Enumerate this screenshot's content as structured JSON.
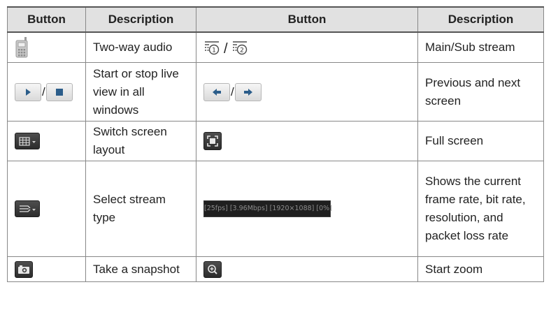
{
  "table": {
    "headers": [
      "Button",
      "Description",
      "Button",
      "Description"
    ],
    "rows": [
      {
        "left_desc": "Two-way audio",
        "right_desc": "Main/Sub stream",
        "left_icon": "phone-icon",
        "right_icon": "main-sub-stream-icon"
      },
      {
        "left_desc": "Start or stop live view in all windows",
        "right_desc": "Previous and next screen",
        "left_icon": "play-stop-icon",
        "right_icon": "prev-next-icon"
      },
      {
        "left_desc": "Switch screen layout",
        "right_desc": "Full screen",
        "left_icon": "grid-layout-icon",
        "right_icon": "fullscreen-icon"
      },
      {
        "left_desc": "Select stream type",
        "right_desc": "Shows the current frame rate, bit rate, resolution, and packet loss rate",
        "left_icon": "stream-type-icon",
        "right_icon": "status-bar",
        "status_text": "[25fps] [3.96Mbps] [1920×1088] [0%]"
      },
      {
        "left_desc": "Take a snapshot",
        "right_desc": "Start zoom",
        "left_icon": "camera-icon",
        "right_icon": "zoom-icon"
      }
    ]
  },
  "glyphs": {
    "slash": "/"
  },
  "colors": {
    "header_bg": "#e1e1e1",
    "icon_dark": "#2c2c2c",
    "border": "#888888"
  }
}
